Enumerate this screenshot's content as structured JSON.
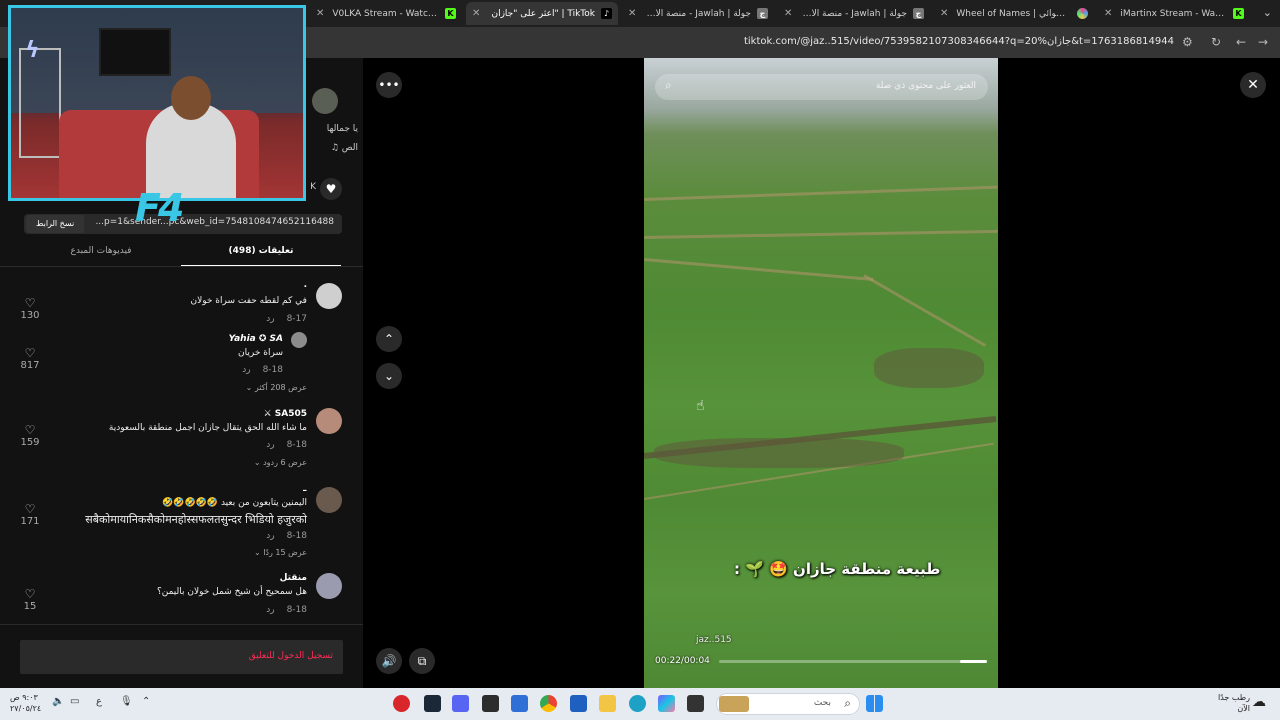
{
  "browser": {
    "tabs": [
      {
        "title": "V0LKA Stream - Watch Live on",
        "favicon": "kick-icon",
        "color": "#53fc18",
        "active": false
      },
      {
        "title": "TikTok | \"اعثر على \"جازان",
        "favicon": "tiktok-icon",
        "color": "#ffffff",
        "active": true
      },
      {
        "title": "جولة | Jawlah - منصة الألعاب الت",
        "favicon": "jawlah-icon",
        "color": "#dddddd",
        "active": false
      },
      {
        "title": "جولة | Jawlah - منصة الألعاب الت",
        "favicon": "jawlah-icon",
        "color": "#dddddd",
        "active": false
      },
      {
        "title": "Wheel of Names | اسم العشوائي",
        "favicon": "wheel-icon",
        "color": "#e44d8f",
        "active": false
      },
      {
        "title": "iMartinx Stream - Watch Live on",
        "favicon": "kick-icon",
        "color": "#53fc18",
        "active": false
      }
    ],
    "url": "tiktok.com/@jaz..515/video/7539582107308346644?q=جازان%20&t=1763186814944"
  },
  "left": {
    "share_url": "...p=1&sender...pc&web_id=7548108474652116488",
    "copy_link": "نسخ الرابط",
    "side_text_1": "يا جمالها",
    "side_text_2": "♫ الص",
    "side_text_3": "K",
    "tabs": {
      "comments": "تعليقات (498)",
      "creator_videos": "فيديوهات المبدع"
    },
    "comments": [
      {
        "user": ".",
        "text": "في كم لقطه حفت سراة خولان",
        "date": "8-17",
        "reply": "رد",
        "likes": "130",
        "more": ""
      },
      {
        "user": "Yahia ✪ SA",
        "text": "سراة خريان",
        "date": "8-18",
        "reply": "رد",
        "likes": "817",
        "more": "عرض 208 أكثر"
      },
      {
        "user": "SA505 ⚔",
        "text": "ما شاء الله الحق يتقال جازان اجمل منطقة بالسعودية",
        "date": "8-18",
        "reply": "رد",
        "likes": "159",
        "more": "عرض 6 ردود"
      },
      {
        "user": "–",
        "text": "اليمنين يتابعون من بعيد 🤣🤣🤣🤣🤣",
        "text2": "सबैकोमायानिकसैकोमनहोस्सफलतसुन्दर भिडियो हजुरको",
        "date": "8-18",
        "reply": "رد",
        "likes": "171",
        "more": "عرض 15 ردًا"
      },
      {
        "user": "منقتل",
        "text": "هل سمحيح أن شيخ شمل خولان باليمن؟",
        "date": "8-18",
        "reply": "رد",
        "likes": "15",
        "more": ""
      }
    ],
    "login": "تسجيل الدخول للتعليق"
  },
  "video": {
    "search_placeholder": "العثور على محتوى ذي صلة",
    "caption": "طبيعة منطقة جازان 🤩 🌱 :",
    "handle": "jaz..515",
    "time": "00:22/00:04",
    "progress": 0.1
  },
  "taskbar": {
    "search_placeholder": "بحث",
    "weather_1": "رطب جدًا",
    "weather_2": "الآن",
    "clock_1": "٩:٠٣ ص",
    "clock_2": "٢٧/٠٥/٢٤",
    "lang": "ع"
  }
}
